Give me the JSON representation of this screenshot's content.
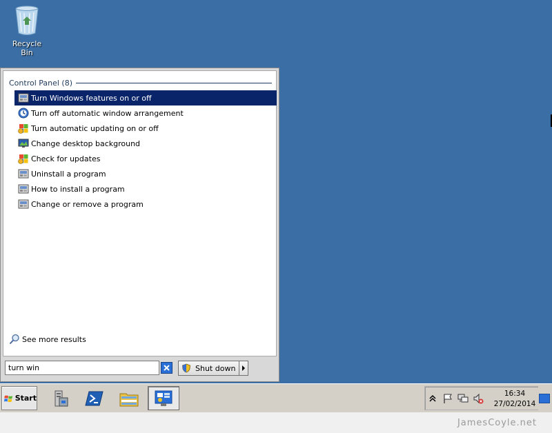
{
  "desktop": {
    "background_color": "#3a6ea5",
    "icons": [
      {
        "label": "Recycle Bin",
        "icon": "recycle-bin-icon"
      }
    ]
  },
  "start_menu": {
    "section_title": "Control Panel (8)",
    "results": [
      {
        "label": "Turn Windows features on or off",
        "icon": "programs-features-icon",
        "selected": true
      },
      {
        "label": "Turn off automatic window arrangement",
        "icon": "ease-of-access-icon",
        "selected": false
      },
      {
        "label": "Turn automatic updating on or off",
        "icon": "windows-update-icon",
        "selected": false
      },
      {
        "label": "Change desktop background",
        "icon": "desktop-background-icon",
        "selected": false
      },
      {
        "label": "Check for updates",
        "icon": "windows-update-icon",
        "selected": false
      },
      {
        "label": "Uninstall a program",
        "icon": "programs-features-icon",
        "selected": false
      },
      {
        "label": "How to install a program",
        "icon": "programs-features-icon",
        "selected": false
      },
      {
        "label": "Change or remove a program",
        "icon": "programs-features-icon",
        "selected": false
      }
    ],
    "see_more": "See more results",
    "search": {
      "value": "turn win",
      "clear_icon": "clear-search-icon"
    },
    "shutdown": {
      "label": "Shut down",
      "icon": "shield-icon",
      "arrow_icon": "chevron-right-icon"
    },
    "selection_color": "#0a246a"
  },
  "taskbar": {
    "start_label": "Start",
    "apps": [
      {
        "name": "server-manager",
        "icon": "server-manager-icon",
        "active": false
      },
      {
        "name": "powershell",
        "icon": "powershell-icon",
        "active": false
      },
      {
        "name": "windows-explorer",
        "icon": "folder-icon",
        "active": false
      },
      {
        "name": "control-panel",
        "icon": "control-panel-icon",
        "active": true
      }
    ],
    "tray": {
      "icons": [
        "show-hidden-icons-chevron-icon",
        "action-center-flag-icon",
        "network-icon",
        "volume-muted-icon"
      ],
      "time": "16:34",
      "date": "27/02/2014"
    }
  },
  "watermark": "JamesCoyle.net"
}
